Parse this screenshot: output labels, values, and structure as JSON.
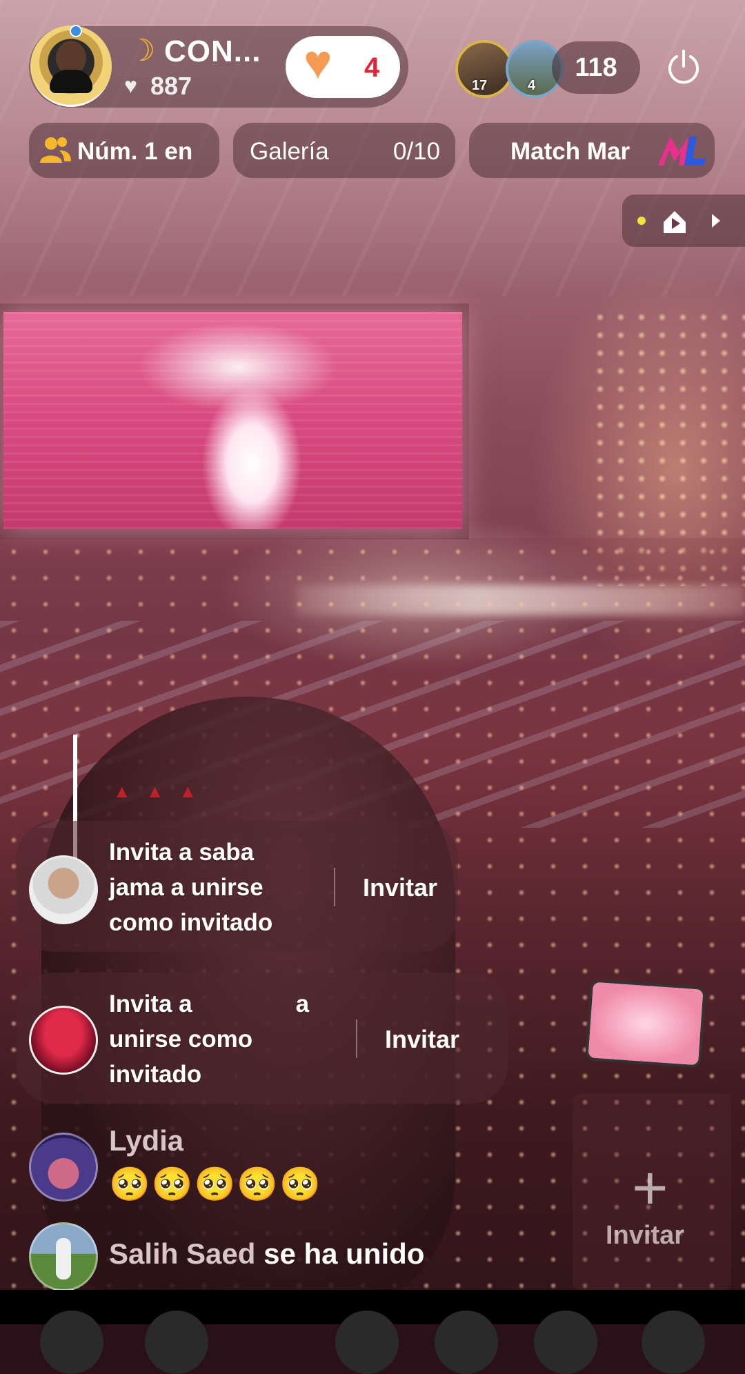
{
  "host": {
    "name": "CON...",
    "likes": "887",
    "follow_count": "4"
  },
  "viewers": {
    "badges": [
      "17",
      "4"
    ],
    "count": "118"
  },
  "row": {
    "rank": "Núm. 1 en",
    "gallery_label": "Galería",
    "gallery_count": "0/10",
    "match": "Match Mar"
  },
  "invite_cards": [
    {
      "lines": [
        "Invita a saba",
        "jama a unirse",
        "como invitado"
      ],
      "button": "Invitar"
    },
    {
      "line1_a": "Invita a",
      "line1_b": "a",
      "lines": [
        "unirse como",
        "invitado"
      ],
      "button": "Invitar"
    }
  ],
  "comments": [
    {
      "user": "Lydia",
      "message": "🥺🥺🥺🥺🥺"
    },
    {
      "user": "Salih Saed",
      "message": "se ha unido"
    }
  ],
  "invite_slot": {
    "label": "Invitar"
  },
  "colors": {
    "follow_heart": "#f59a52",
    "follow_count": "#e0243a",
    "moon": "#f5b82a",
    "people_icon": "#f5b82a"
  }
}
